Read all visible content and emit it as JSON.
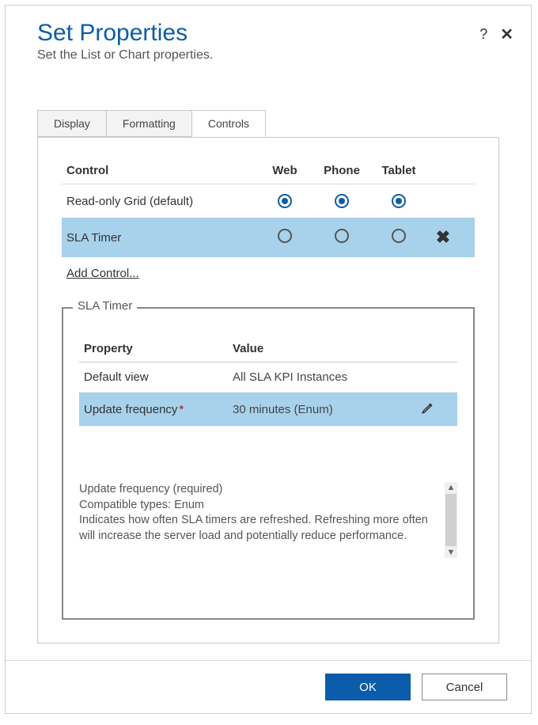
{
  "dialog": {
    "title": "Set Properties",
    "subtitle": "Set the List or Chart properties."
  },
  "tabs": {
    "items": [
      "Display",
      "Formatting",
      "Controls"
    ],
    "active_index": 2
  },
  "controls_table": {
    "headers": {
      "control": "Control",
      "web": "Web",
      "phone": "Phone",
      "tablet": "Tablet"
    },
    "rows": [
      {
        "label": "Read-only Grid (default)",
        "web": true,
        "phone": true,
        "tablet": true,
        "removable": false,
        "selected": false
      },
      {
        "label": "SLA Timer",
        "web": false,
        "phone": false,
        "tablet": false,
        "removable": true,
        "selected": true
      }
    ],
    "add_link": "Add Control..."
  },
  "properties_panel": {
    "legend": "SLA Timer",
    "headers": {
      "property": "Property",
      "value": "Value"
    },
    "rows": [
      {
        "name": "Default view",
        "value": "All SLA KPI Instances",
        "required": false,
        "selected": false,
        "editable": false
      },
      {
        "name": "Update frequency",
        "value": "30 minutes (Enum)",
        "required": true,
        "selected": true,
        "editable": true
      }
    ],
    "description": {
      "line1": "Update frequency (required)",
      "line2": "Compatible types: Enum",
      "line3": "Indicates how often SLA timers are refreshed. Refreshing more often will increase the server load and potentially reduce performance."
    }
  },
  "footer": {
    "ok": "OK",
    "cancel": "Cancel"
  }
}
